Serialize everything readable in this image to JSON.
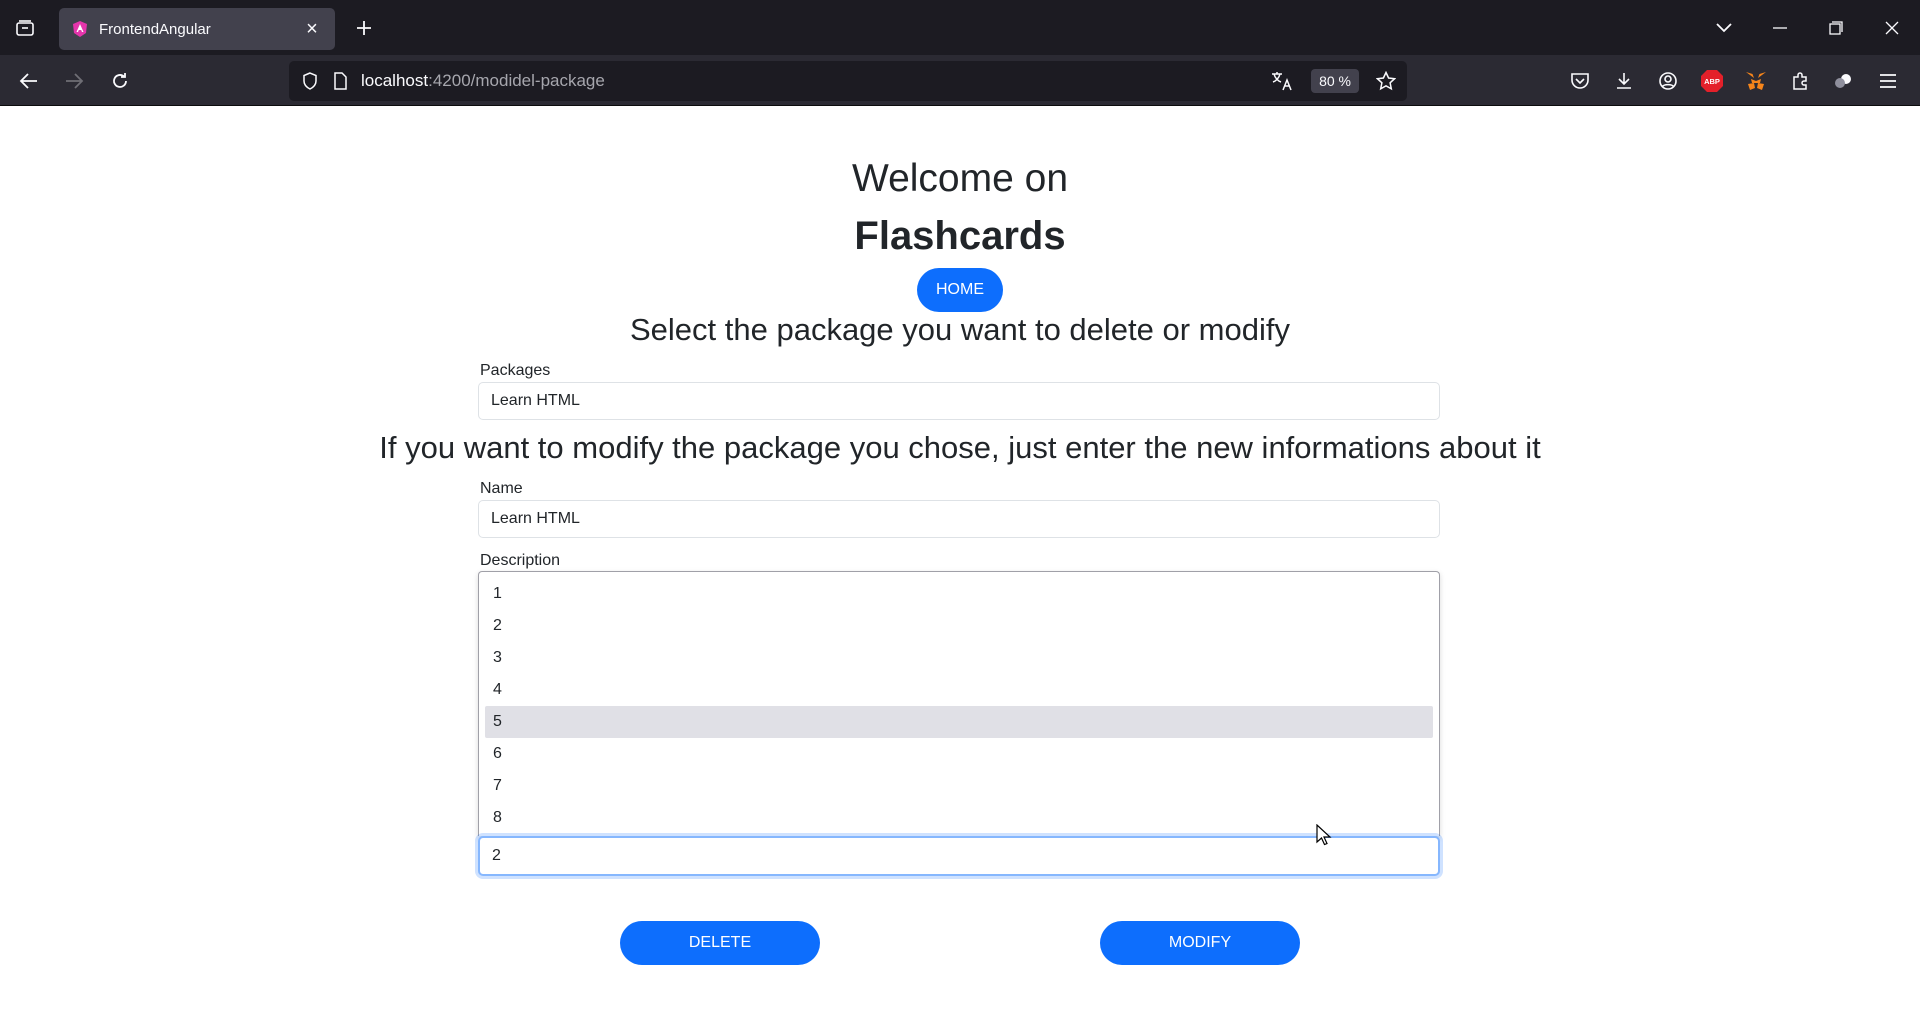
{
  "browser": {
    "tab_title": "FrontendAngular",
    "url_host": "localhost",
    "url_path": ":4200/modidel-package",
    "zoom": "80 %",
    "icons": [
      "tab-list-icon",
      "angular-favicon",
      "close-icon",
      "plus-icon",
      "chevron-down-icon",
      "minimize-icon",
      "restore-icon",
      "window-close-icon",
      "back-icon",
      "forward-icon",
      "reload-icon",
      "shield-icon",
      "page-icon",
      "translate-icon",
      "star-icon",
      "pocket-icon",
      "download-icon",
      "account-icon",
      "adblock-icon",
      "metamask-icon",
      "extensions-icon",
      "profile-icon",
      "menu-icon"
    ],
    "adblock_label": "ABP"
  },
  "page": {
    "welcome": "Welcome on",
    "brand": "Flashcards",
    "home_label": "HOME",
    "select_heading": "Select the package you want to delete or modify",
    "packages_label": "Packages",
    "packages_value": "Learn HTML",
    "modify_heading": "If you want to modify the package you chose, just enter the new informations about it",
    "name_label": "Name",
    "name_value": "Learn HTML",
    "description_label": "Description",
    "dropdown_options": [
      "1",
      "2",
      "3",
      "4",
      "5",
      "6",
      "7",
      "8"
    ],
    "dropdown_hovered": "5",
    "selected_value": "2",
    "delete_label": "DELETE",
    "modify_label": "MODIFY"
  },
  "colors": {
    "primary": "#0d6efd",
    "tabbar_bg": "#1c1b22",
    "navbar_bg": "#2b2a33"
  }
}
